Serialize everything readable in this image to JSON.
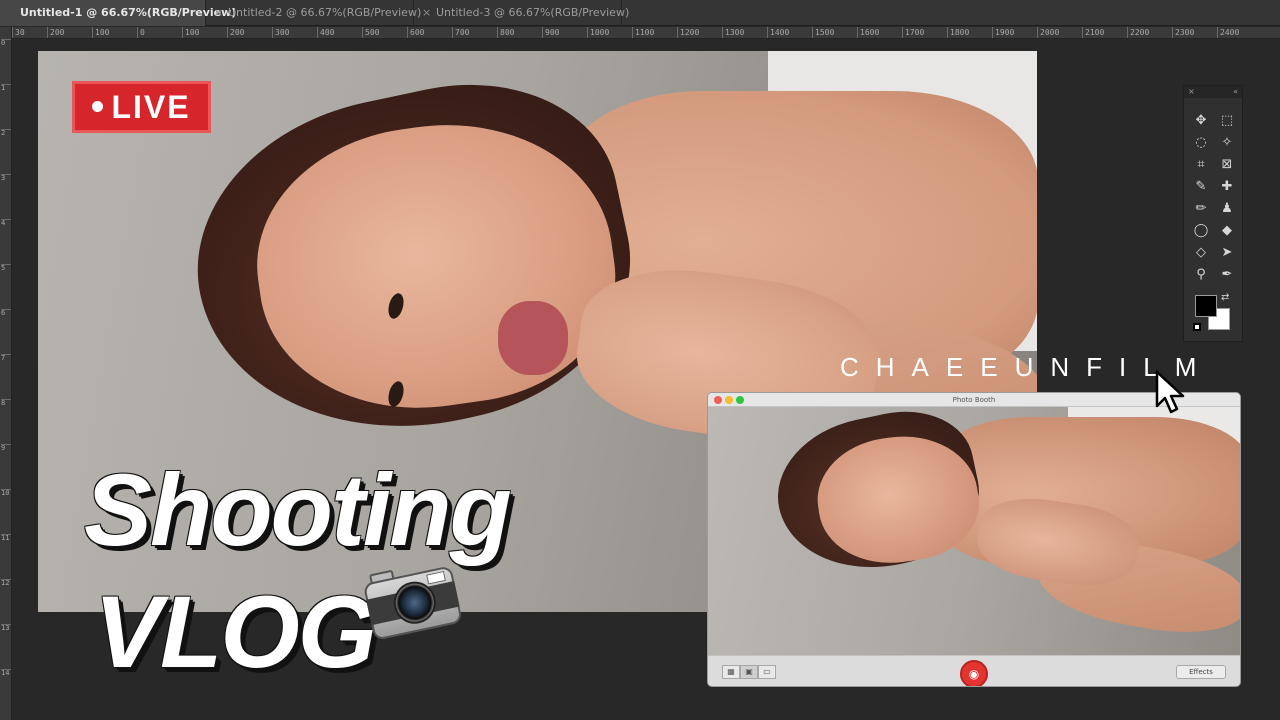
{
  "tabs": [
    {
      "label": "Untitled-1 @ 66.67%(RGB/Preview)",
      "active": true
    },
    {
      "label": "Untitled-2 @ 66.67%(RGB/Preview)",
      "active": false
    },
    {
      "label": "Untitled-3 @ 66.67%(RGB/Preview)",
      "active": false
    }
  ],
  "tab_close_glyph": "×",
  "ruler": {
    "h_ticks": [
      "30",
      "200",
      "100",
      "0",
      "100",
      "200",
      "300",
      "400",
      "500",
      "600",
      "700",
      "800",
      "900",
      "1000",
      "1100",
      "1200",
      "1300",
      "1400",
      "1500",
      "1600",
      "1700",
      "1800",
      "1900",
      "2000",
      "2100",
      "2200",
      "2300",
      "2400"
    ],
    "v_ticks": [
      "0",
      "1",
      "2",
      "3",
      "4",
      "5",
      "6",
      "7",
      "8",
      "9",
      "10",
      "11",
      "12",
      "13",
      "14"
    ]
  },
  "overlay": {
    "live_label": "LIVE",
    "title_line1": "Shooting",
    "title_line2": "VLOG",
    "brand": "CHAEEUNFILM"
  },
  "colors": {
    "live_red": "#d6262c",
    "shutter_red": "#e3342f",
    "panel_bg": "#303030"
  },
  "tools_panel": {
    "tools": [
      "move-icon",
      "marquee-icon",
      "lasso-icon",
      "magic-wand-icon",
      "crop-icon",
      "frame-icon",
      "eyedropper-icon",
      "healing-icon",
      "brush-icon",
      "stamp-icon",
      "history-brush-icon",
      "eraser-icon",
      "paint-bucket-icon",
      "path-select-icon",
      "dodge-icon",
      "pen-icon"
    ],
    "foreground": "#000000",
    "background": "#ffffff"
  },
  "photo_booth": {
    "title": "Photo Booth",
    "effects_label": "Effects"
  }
}
